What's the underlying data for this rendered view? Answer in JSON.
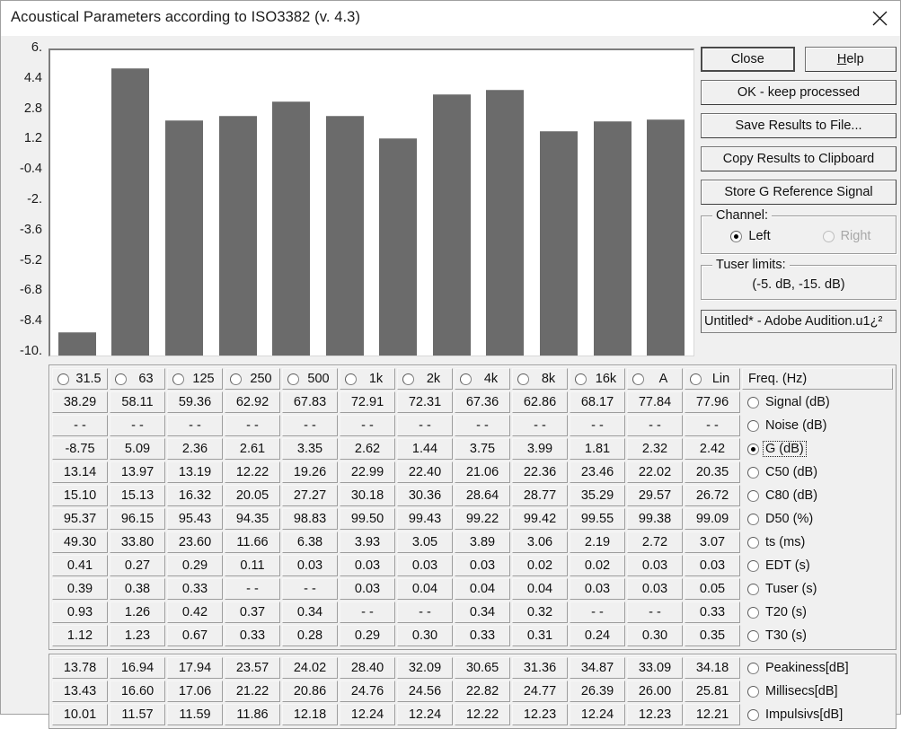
{
  "window": {
    "title": "Acoustical Parameters according to ISO3382 (v. 4.3)",
    "close_icon": "close-icon"
  },
  "chart_data": {
    "type": "bar",
    "title": "",
    "xlabel": "",
    "ylabel": "",
    "categories": [
      "31.5",
      "63",
      "125",
      "250",
      "500",
      "1k",
      "2k",
      "4k",
      "8k",
      "16k",
      "A",
      "Lin"
    ],
    "values": [
      -8.75,
      5.09,
      2.36,
      2.61,
      3.35,
      2.62,
      1.44,
      3.75,
      3.99,
      1.81,
      2.32,
      2.42
    ],
    "series_name": "G (dB)",
    "ylim": [
      -10.0,
      6.0
    ],
    "ytick_labels": [
      "6.",
      "4.4",
      "2.8",
      "1.2",
      "-0.4",
      "-2.",
      "-3.6",
      "-5.2",
      "-6.8",
      "-8.4",
      "-10."
    ],
    "ytick_values": [
      6.0,
      4.4,
      2.8,
      1.2,
      -0.4,
      -2.0,
      -3.6,
      -5.2,
      -6.8,
      -8.4,
      -10.0
    ],
    "grid": false,
    "legend": "none",
    "bar_color": "#6b6b6b",
    "plot_background": "#ffffff"
  },
  "buttons": {
    "close": "Close",
    "help_prefix": "",
    "help_underlined": "H",
    "help_suffix": "elp",
    "ok_keep": "OK - keep processed",
    "save_results": "Save Results to File...",
    "copy_results": "Copy Results to Clipboard",
    "store_g": "Store G Reference Signal"
  },
  "channel_group": {
    "legend": "Channel:",
    "left_label": "Left",
    "right_label": "Right",
    "selected": "Left"
  },
  "tuser_group": {
    "legend": "Tuser  limits:",
    "value": "(-5. dB, -15. dB)"
  },
  "source_field": {
    "value": "Untitled* - Adobe Audition.u1¿²"
  },
  "table": {
    "header": {
      "columns": [
        "31.5",
        "63",
        "125",
        "250",
        "500",
        "1k",
        "2k",
        "4k",
        "8k",
        "16k",
        "A",
        "Lin"
      ],
      "label": "Freq. (Hz)",
      "selected_column": ""
    },
    "rows": [
      {
        "label": "Signal (dB)",
        "selected": false,
        "values": [
          "38.29",
          "58.11",
          "59.36",
          "62.92",
          "67.83",
          "72.91",
          "72.31",
          "67.36",
          "62.86",
          "68.17",
          "77.84",
          "77.96"
        ]
      },
      {
        "label": "Noise (dB)",
        "selected": false,
        "values": [
          "- -",
          "- -",
          "- -",
          "- -",
          "- -",
          "- -",
          "- -",
          "- -",
          "- -",
          "- -",
          "- -",
          "- -"
        ]
      },
      {
        "label": "G (dB)",
        "selected": true,
        "values": [
          "-8.75",
          "5.09",
          "2.36",
          "2.61",
          "3.35",
          "2.62",
          "1.44",
          "3.75",
          "3.99",
          "1.81",
          "2.32",
          "2.42"
        ]
      },
      {
        "label": "C50 (dB)",
        "selected": false,
        "values": [
          "13.14",
          "13.97",
          "13.19",
          "12.22",
          "19.26",
          "22.99",
          "22.40",
          "21.06",
          "22.36",
          "23.46",
          "22.02",
          "20.35"
        ]
      },
      {
        "label": "C80 (dB)",
        "selected": false,
        "values": [
          "15.10",
          "15.13",
          "16.32",
          "20.05",
          "27.27",
          "30.18",
          "30.36",
          "28.64",
          "28.77",
          "35.29",
          "29.57",
          "26.72"
        ]
      },
      {
        "label": "D50 (%)",
        "selected": false,
        "values": [
          "95.37",
          "96.15",
          "95.43",
          "94.35",
          "98.83",
          "99.50",
          "99.43",
          "99.22",
          "99.42",
          "99.55",
          "99.38",
          "99.09"
        ]
      },
      {
        "label": "ts (ms)",
        "selected": false,
        "values": [
          "49.30",
          "33.80",
          "23.60",
          "11.66",
          "6.38",
          "3.93",
          "3.05",
          "3.89",
          "3.06",
          "2.19",
          "2.72",
          "3.07"
        ]
      },
      {
        "label": "EDT (s)",
        "selected": false,
        "values": [
          "0.41",
          "0.27",
          "0.29",
          "0.11",
          "0.03",
          "0.03",
          "0.03",
          "0.03",
          "0.02",
          "0.02",
          "0.03",
          "0.03"
        ]
      },
      {
        "label": "Tuser (s)",
        "selected": false,
        "values": [
          "0.39",
          "0.38",
          "0.33",
          "- -",
          "- -",
          "0.03",
          "0.04",
          "0.04",
          "0.04",
          "0.03",
          "0.03",
          "0.05"
        ]
      },
      {
        "label": "T20 (s)",
        "selected": false,
        "values": [
          "0.93",
          "1.26",
          "0.42",
          "0.37",
          "0.34",
          "- -",
          "- -",
          "0.34",
          "0.32",
          "- -",
          "- -",
          "0.33"
        ]
      },
      {
        "label": "T30 (s)",
        "selected": false,
        "values": [
          "1.12",
          "1.23",
          "0.67",
          "0.33",
          "0.28",
          "0.29",
          "0.30",
          "0.33",
          "0.31",
          "0.24",
          "0.30",
          "0.35"
        ]
      }
    ],
    "rows2": [
      {
        "label": "Peakiness[dB]",
        "selected": false,
        "values": [
          "13.78",
          "16.94",
          "17.94",
          "23.57",
          "24.02",
          "28.40",
          "32.09",
          "30.65",
          "31.36",
          "34.87",
          "33.09",
          "34.18"
        ]
      },
      {
        "label": "Millisecs[dB]",
        "selected": false,
        "values": [
          "13.43",
          "16.60",
          "17.06",
          "21.22",
          "20.86",
          "24.76",
          "24.56",
          "22.82",
          "24.77",
          "26.39",
          "26.00",
          "25.81"
        ]
      },
      {
        "label": "Impulsivs[dB]",
        "selected": false,
        "values": [
          "10.01",
          "11.57",
          "11.59",
          "11.86",
          "12.18",
          "12.24",
          "12.24",
          "12.22",
          "12.23",
          "12.24",
          "12.23",
          "12.21"
        ]
      }
    ]
  }
}
